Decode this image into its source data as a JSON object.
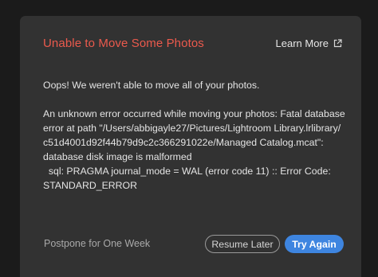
{
  "dialog": {
    "title": "Unable to Move Some Photos",
    "learn_more_label": "Learn More",
    "learn_more_icon": "external-link-icon",
    "message_intro": "Oops! We weren't able to move all of your photos.",
    "message_detail": "An unknown error occurred while moving your photos: Fatal database error at path \"/Users/abbigayle27/Pictures/Lightroom Library.lrlibrary/\nc51d4001d92f44b79d9c2c366291022e/Managed Catalog.mcat\": database disk image is malformed\n  sql: PRAGMA journal_mode = WAL (error code 11) :: Error Code: STANDARD_ERROR",
    "postpone_label": "Postpone for One Week",
    "resume_later_label": "Resume Later",
    "try_again_label": "Try Again"
  },
  "colors": {
    "title": "#eb5a4d",
    "primary_button": "#3e85e0",
    "dialog_bg": "#323232",
    "page_bg": "#1b1b1b"
  }
}
